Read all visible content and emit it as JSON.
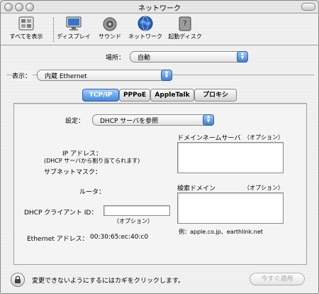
{
  "window": {
    "title": "ネットワーク"
  },
  "toolbar": {
    "items": [
      {
        "label": "すべてを表示",
        "icon": "show-all-icon"
      },
      {
        "label": "ディスプレイ",
        "icon": "display-icon"
      },
      {
        "label": "サウンド",
        "icon": "sound-icon"
      },
      {
        "label": "ネットワーク",
        "icon": "network-icon"
      },
      {
        "label": "起動ディスク",
        "icon": "startup-disk-icon"
      }
    ]
  },
  "location": {
    "label": "場所：",
    "value": "自動"
  },
  "show": {
    "label": "表示：",
    "value": "内蔵 Ethernet"
  },
  "tabs": [
    {
      "label": "TCP/IP",
      "selected": true
    },
    {
      "label": "PPPoE",
      "selected": false
    },
    {
      "label": "AppleTalk",
      "selected": false
    },
    {
      "label": "プロキシ",
      "selected": false
    }
  ],
  "config": {
    "label": "設定：",
    "value": "DHCP サーバを参照"
  },
  "fields": {
    "ip_label": "IP アドレス：",
    "ip_note": "(DHCP サーバから割り当てられます)",
    "subnet_label": "サブネットマスク：",
    "router_label": "ルータ：",
    "dhcp_client_label": "DHCP クライアント ID：",
    "dhcp_client_value": "",
    "dhcp_optional": "（オプション）",
    "ethernet_label": "Ethernet アドレス：",
    "ethernet_value": "00:30:65:ec:40:c0"
  },
  "dns": {
    "label": "ドメインネームサーバ",
    "optional": "（オプション）",
    "value": ""
  },
  "search": {
    "label": "検索ドメイン",
    "optional": "（オプション）",
    "value": ""
  },
  "example": {
    "text": "例：apple.co.jp、earthlink.net"
  },
  "status": {
    "lock_text": "変更できないようにするにはカギをクリックします。",
    "apply_label": "今すぐ適用"
  },
  "colors": {
    "accent": "#3e86e2",
    "window_bg": "#efefef"
  }
}
